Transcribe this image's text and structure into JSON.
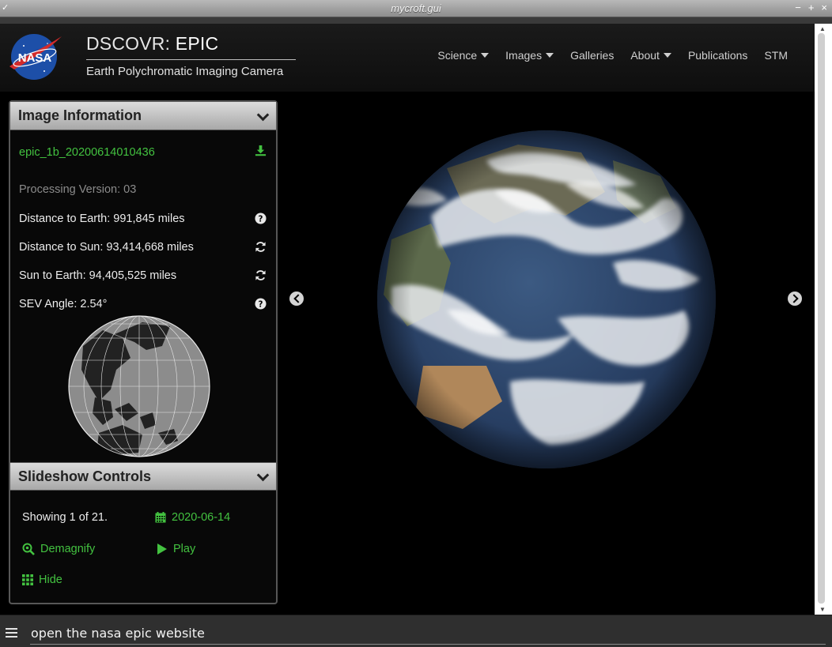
{
  "window": {
    "title": "mycroft.gui",
    "controls": {
      "minimize": "−",
      "maximize": "+",
      "close": "×"
    }
  },
  "header": {
    "logo": "NASA",
    "title_prefix": "DSCOVR:",
    "title_strong": "EPIC",
    "subtitle": "Earth Polychromatic Imaging Camera",
    "nav": [
      {
        "label": "Science",
        "dropdown": true
      },
      {
        "label": "Images",
        "dropdown": true
      },
      {
        "label": "Galleries",
        "dropdown": false
      },
      {
        "label": "About",
        "dropdown": true
      },
      {
        "label": "Publications",
        "dropdown": false
      },
      {
        "label": "STM",
        "dropdown": false
      }
    ]
  },
  "image_info": {
    "heading": "Image Information",
    "filename": "epic_1b_20200614010436",
    "processing_version": "Processing Version: 03",
    "distance_to_earth": "Distance to Earth: 991,845 miles",
    "distance_to_sun": "Distance to Sun: 93,414,668 miles",
    "sun_to_earth": "Sun to Earth: 94,405,525 miles",
    "sev_angle": "SEV Angle: 2.54°"
  },
  "slideshow": {
    "heading": "Slideshow Controls",
    "showing": "Showing 1 of 21.",
    "date": "2020-06-14",
    "demagnify": "Demagnify",
    "play": "Play",
    "hide": "Hide"
  },
  "command_bar": {
    "input_value": "open the nasa epic website"
  },
  "colors": {
    "accent_green": "#43c240",
    "panel_header": "#c4c4c4",
    "background": "#000000"
  }
}
